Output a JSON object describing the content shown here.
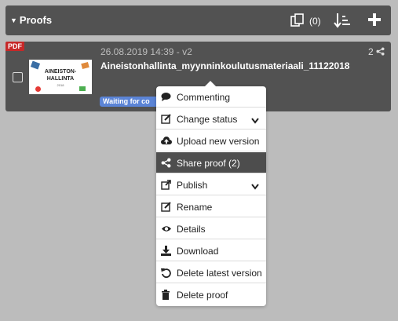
{
  "header": {
    "title": "Proofs",
    "proof_count": "(0)"
  },
  "proof": {
    "file_type": "PDF",
    "meta": "26.08.2019 14:39 - v2",
    "filename": "Aineistonhallinta_myynninkoulutusmateriaali_11122018",
    "version_count": "2",
    "status": "Waiting for co",
    "thumbnail": {
      "line1": "AINEISTON-",
      "line2": "HALLINTA",
      "line3": "2018"
    }
  },
  "menu": {
    "items": [
      {
        "label": "Commenting",
        "icon": "comment-icon"
      },
      {
        "label": "Change status",
        "icon": "edit-icon"
      },
      {
        "label": "Upload new version",
        "icon": "cloud-upload-icon"
      },
      {
        "label": "Share proof (2)",
        "icon": "share-icon"
      },
      {
        "label": "Publish",
        "icon": "external-link-icon"
      },
      {
        "label": "Rename",
        "icon": "edit-icon"
      },
      {
        "label": "Details",
        "icon": "eye-icon"
      },
      {
        "label": "Download",
        "icon": "download-icon"
      },
      {
        "label": "Delete latest version",
        "icon": "undo-icon"
      },
      {
        "label": "Delete proof",
        "icon": "trash-icon"
      }
    ]
  },
  "colors": {
    "header_bg": "#525252",
    "page_bg": "#bcbcbc",
    "status_badge": "#5b84d6",
    "pdf_badge": "#c62828",
    "menu_active": "#4d4d4d"
  }
}
